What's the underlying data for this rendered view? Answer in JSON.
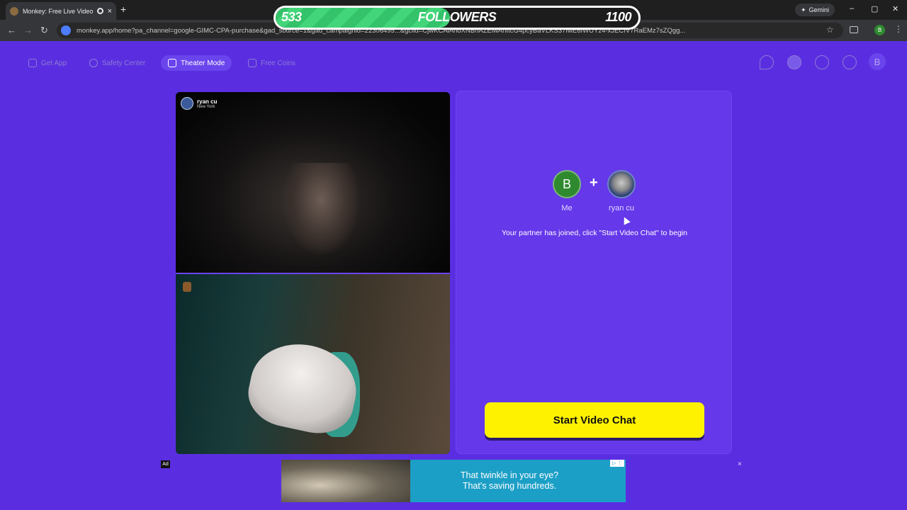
{
  "browser": {
    "tab_title": "Monkey: Free Live Video Ch",
    "tab_close": "×",
    "new_tab": "+",
    "gemini_label": "Gemini",
    "url": "monkey.app/home?pa_channel=google-GIMC-CPA-purchase&gad_source=1&gad_campaignid=22306495...&gclid=CjwKCAiAnoXNBhAZEiwAnItcG4pcyBaVLKS37IwE6IWUYz4-xJECfV7RaEMz7sZQgg...",
    "controls": {
      "minimize": "–",
      "maximize": "▢",
      "close": "✕"
    }
  },
  "followers": {
    "current": "533",
    "label": "FOLLOWERS",
    "goal": "1100",
    "progress_fraction": 0.48
  },
  "nav": {
    "items": [
      {
        "label": "Get App"
      },
      {
        "label": "Safety Center"
      },
      {
        "label": "Theater Mode"
      },
      {
        "label": "Free Coins"
      }
    ],
    "user_initial": "B"
  },
  "video": {
    "peer_name": "ryan cu",
    "peer_location": "New York"
  },
  "match": {
    "me_initial": "B",
    "plus": "+",
    "me_label": "Me",
    "peer_label": "ryan cu",
    "status": "Your partner has joined, click \"Start Video Chat\" to begin",
    "start_button": "Start Video Chat"
  },
  "ad": {
    "badge": "Ad",
    "line1": "That twinkle in your eye?",
    "line2": "That's saving hundreds.",
    "close": "×"
  },
  "colors": {
    "app_background": "#5a2ee0",
    "panel": "#6538ea",
    "start_button": "#fff200",
    "followers_fill": "#34c36a"
  }
}
